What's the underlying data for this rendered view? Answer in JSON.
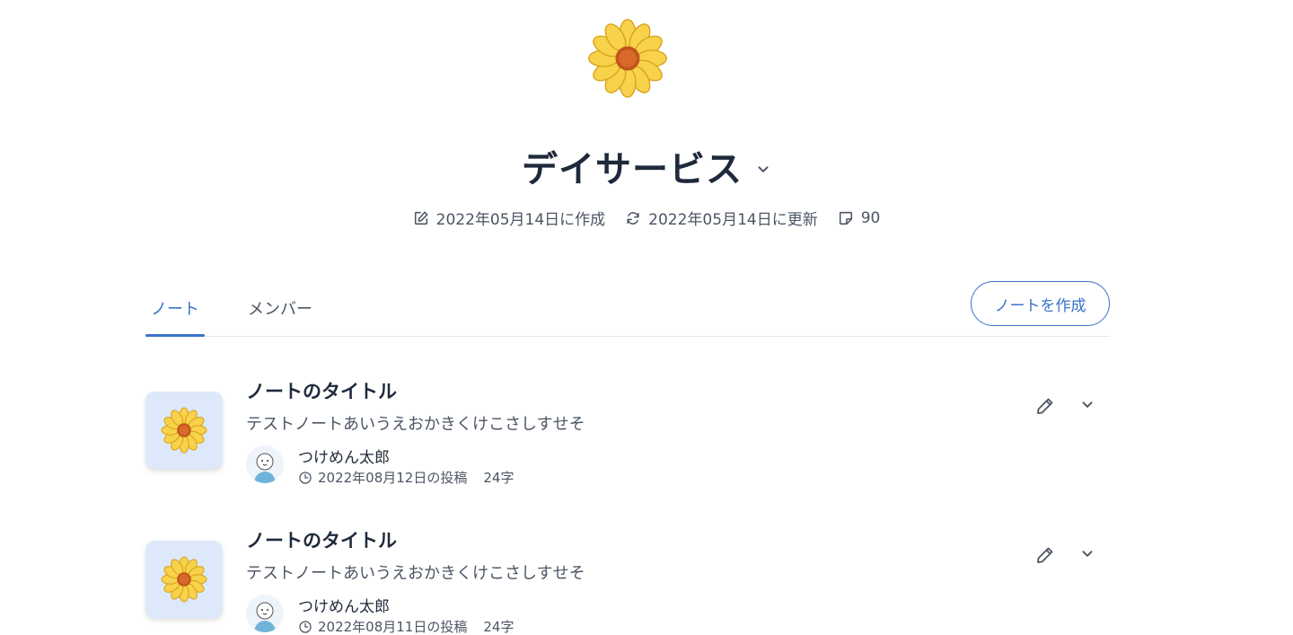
{
  "header": {
    "icon": "sunflower-icon",
    "title": "デイサービス",
    "created": "2022年05月14日に作成",
    "updated": "2022年05月14日に更新",
    "note_count": "90"
  },
  "tabs": [
    {
      "label": "ノート",
      "active": true
    },
    {
      "label": "メンバー",
      "active": false
    }
  ],
  "create_button": "ノートを作成",
  "notes": [
    {
      "title": "ノートのタイトル",
      "body": "テストノートあいうえおかきくけこさしすせそ",
      "author": "つけめん太郎",
      "posted": "2022年08月12日の投稿",
      "chars": "24字"
    },
    {
      "title": "ノートのタイトル",
      "body": "テストノートあいうえおかきくけこさしすせそ",
      "author": "つけめん太郎",
      "posted": "2022年08月11日の投稿",
      "chars": "24字"
    }
  ],
  "colors": {
    "accent": "#3b72c8",
    "thumb_bg": "#dde9fb",
    "text_dark": "#1e293b",
    "text_muted": "#4b5563"
  }
}
